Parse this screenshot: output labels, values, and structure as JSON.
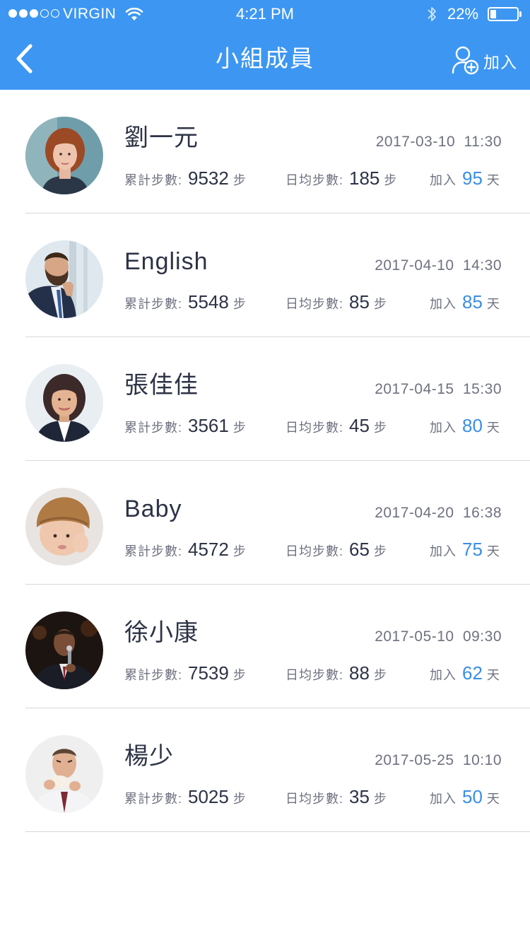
{
  "status_bar": {
    "carrier": "VIRGIN",
    "time": "4:21 PM",
    "battery": "22%",
    "battery_level": 0.22,
    "signal_bars": 3
  },
  "nav": {
    "title": "小組成員",
    "join_label": "加入"
  },
  "labels": {
    "total_steps": "累計步數:",
    "daily_steps": "日均步數:",
    "steps_unit": "步",
    "joined": "加入",
    "days_unit": "天"
  },
  "colors": {
    "brand": "#3d97f2",
    "accent_number": "#3a8ee6"
  },
  "members": [
    {
      "name": "劉一元",
      "datetime": "2017-03-10  11:30",
      "total_steps": "9532",
      "daily_steps": "185",
      "days_joined": "95",
      "avatar": "woman-red-hair"
    },
    {
      "name": "English",
      "datetime": "2017-04-10  14:30",
      "total_steps": "5548",
      "daily_steps": "85",
      "days_joined": "85",
      "avatar": "bearded-man-suit"
    },
    {
      "name": "張佳佳",
      "datetime": "2017-04-15  15:30",
      "total_steps": "3561",
      "daily_steps": "45",
      "days_joined": "80",
      "avatar": "smiling-woman-blazer"
    },
    {
      "name": "Baby",
      "datetime": "2017-04-20  16:38",
      "total_steps": "4572",
      "daily_steps": "65",
      "days_joined": "75",
      "avatar": "baby-knit-hat"
    },
    {
      "name": "徐小康",
      "datetime": "2017-05-10  09:30",
      "total_steps": "7539",
      "daily_steps": "88",
      "days_joined": "62",
      "avatar": "man-microphone"
    },
    {
      "name": "楊少",
      "datetime": "2017-05-25  10:10",
      "total_steps": "5025",
      "daily_steps": "35",
      "days_joined": "50",
      "avatar": "man-eating"
    }
  ]
}
